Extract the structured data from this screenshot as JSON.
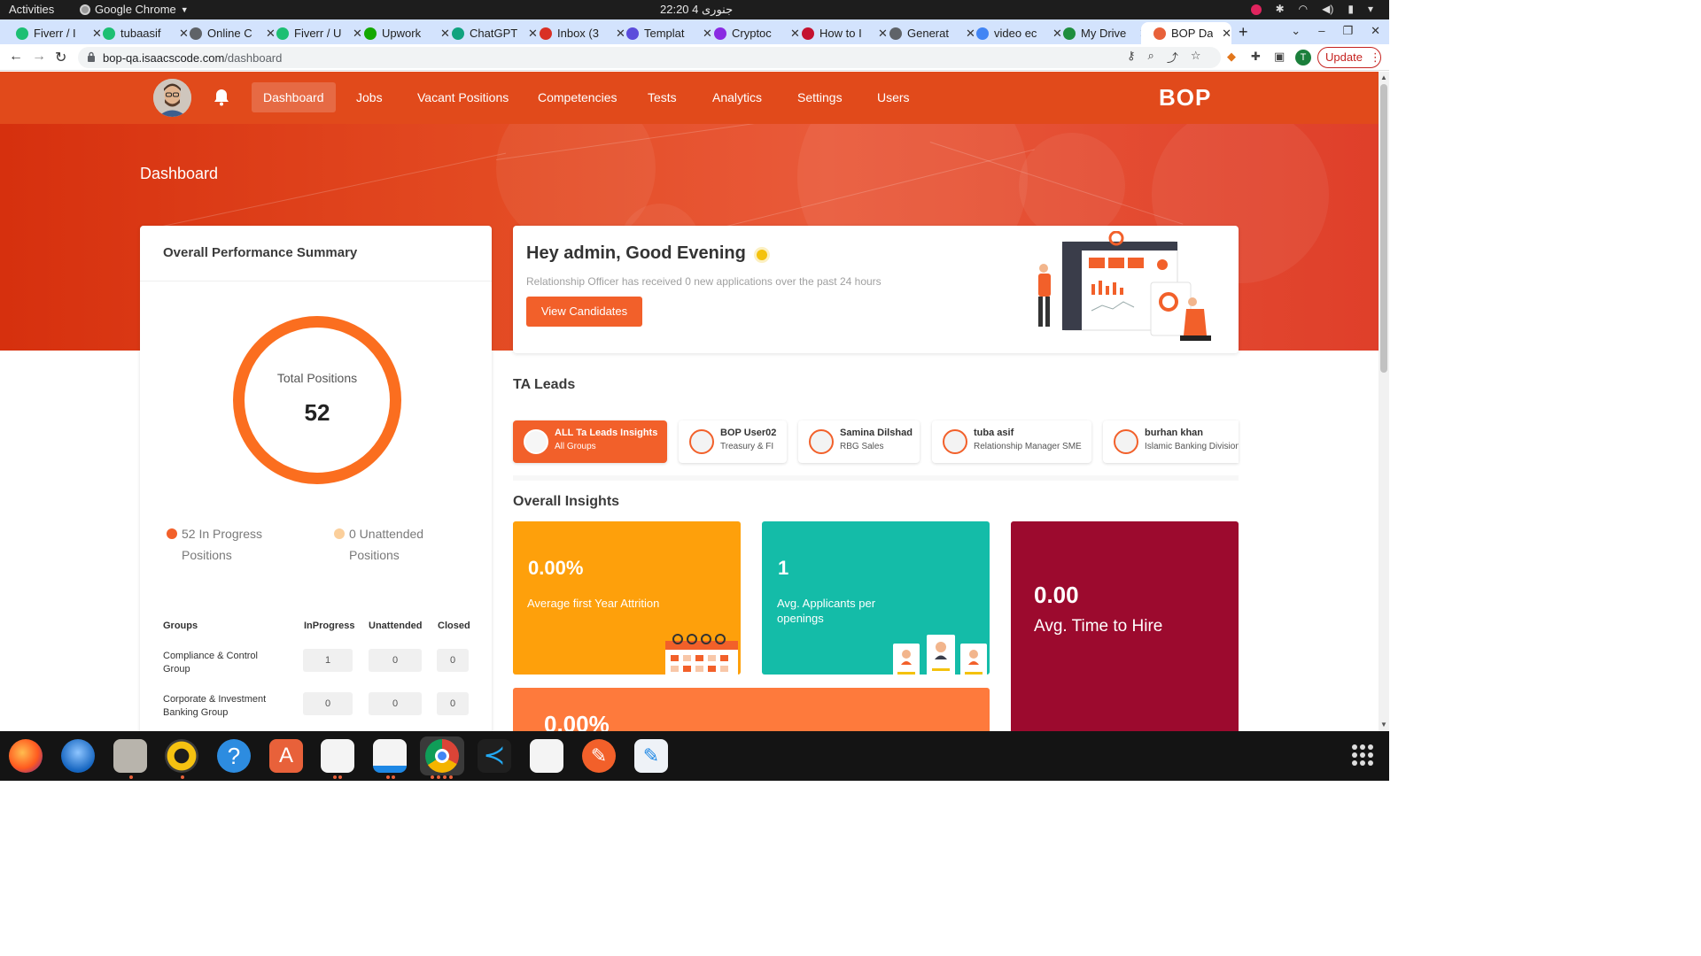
{
  "system": {
    "activities": "Activities",
    "app_name": "Google Chrome",
    "clock": "22:20  4 جنوری"
  },
  "browser": {
    "tabs": [
      {
        "label": "Fiverr / I",
        "color": "#1dbf73"
      },
      {
        "label": "tubaasif",
        "color": "#1dbf73"
      },
      {
        "label": "Online C",
        "color": "#5f6368"
      },
      {
        "label": "Fiverr / U",
        "color": "#1dbf73"
      },
      {
        "label": "Upwork",
        "color": "#14a800"
      },
      {
        "label": "ChatGPT",
        "color": "#10a37f"
      },
      {
        "label": "Inbox (3",
        "color": "#d93025"
      },
      {
        "label": "Templat",
        "color": "#5b4cdb"
      },
      {
        "label": "Cryptoc",
        "color": "#8a2be2"
      },
      {
        "label": "How to I",
        "color": "#c4122f"
      },
      {
        "label": "Generat",
        "color": "#5f6368"
      },
      {
        "label": "video ec",
        "color": "#4285f4"
      },
      {
        "label": "My Drive",
        "color": "#1e8e3e"
      },
      {
        "label": "BOP Das",
        "color": "#e8613a"
      }
    ],
    "new_tab": "+",
    "url_host": "bop-qa.isaacscode.com",
    "url_path": "/dashboard",
    "profile_initial": "T",
    "update_label": "Update"
  },
  "nav": {
    "items": [
      "Dashboard",
      "Jobs",
      "Vacant Positions",
      "Competencies",
      "Tests",
      "Analytics",
      "Settings",
      "Users"
    ],
    "logo": "BOP"
  },
  "hero": {
    "title": "Dashboard"
  },
  "performance": {
    "title": "Overall Performance Summary",
    "ring_label": "Total Positions",
    "ring_value": "52",
    "in_progress": "52 In Progress",
    "in_progress_line2": "Positions",
    "unattended": "0 Unattended",
    "unattended_line2": "Positions",
    "in_progress_color": "#f2602a",
    "unattended_color": "#fbcf9b",
    "table": {
      "headers": [
        "Groups",
        "InProgress",
        "Unattended",
        "Closed"
      ],
      "rows": [
        {
          "group": "Compliance & Control Group",
          "inprogress": "1",
          "unattended": "0",
          "closed": "0"
        },
        {
          "group": "Corporate & Investment Banking Group",
          "inprogress": "0",
          "unattended": "0",
          "closed": "0"
        }
      ]
    }
  },
  "greeting": {
    "title": "Hey admin, Good Evening",
    "message": "Relationship Officer has received 0 new applications over the past 24 hours",
    "button": "View Candidates"
  },
  "ta_leads": {
    "title": "TA Leads",
    "items": [
      {
        "name": "ALL Ta Leads Insights",
        "sub": "All Groups"
      },
      {
        "name": "BOP User02",
        "sub": "Treasury & FI"
      },
      {
        "name": "Samina Dilshad",
        "sub": "RBG Sales"
      },
      {
        "name": "tuba asif",
        "sub": "Relationship Manager SME"
      },
      {
        "name": "burhan khan",
        "sub": "Islamic Banking Division"
      }
    ]
  },
  "insights": {
    "title": "Overall Insights",
    "cards": [
      {
        "value": "0.00%",
        "label": "Average first Year Attrition",
        "color": "#fea00b"
      },
      {
        "value": "1",
        "label": "Avg. Applicants per openings",
        "color": "#14bca8"
      },
      {
        "value": "0.00",
        "label": "Avg. Time to Hire",
        "color": "#9c0a2e"
      },
      {
        "value": "0.00%",
        "label": "",
        "color": "#fe7a3c"
      }
    ]
  },
  "colors": {
    "brand": "#e14a1b",
    "accent": "#f2602a"
  }
}
